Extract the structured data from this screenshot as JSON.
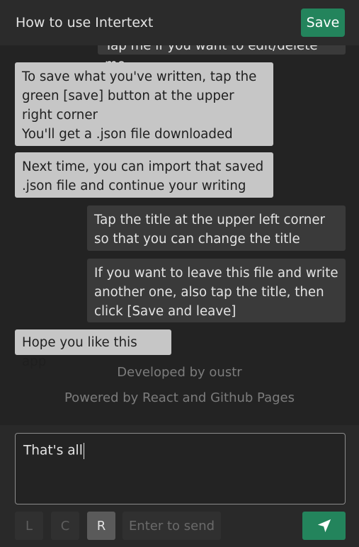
{
  "header": {
    "title": "How to use Intertext",
    "save_label": "Save"
  },
  "messages": [
    {
      "side": "right",
      "text": "Tap me if you want to edit/delete me"
    },
    {
      "side": "left",
      "text": "To save what you've written, tap the green [save] button at the upper right corner\nYou'll get a .json file downloaded"
    },
    {
      "side": "left",
      "text": "Next time, you can import that saved .json file and continue your writing"
    },
    {
      "side": "right",
      "text": "Tap the title at the upper left corner so that you can change the title"
    },
    {
      "side": "right",
      "text": "If you want to leave this file and write another one, also tap the title, then click [Save and leave]"
    },
    {
      "side": "left",
      "text": "Hope you like this app"
    }
  ],
  "footer": {
    "developer": "Developed by oustr",
    "powered": "Powered by React and Github Pages"
  },
  "composer": {
    "text": "That's all",
    "align_buttons": [
      {
        "label": "L",
        "active": false
      },
      {
        "label": "C",
        "active": false
      },
      {
        "label": "R",
        "active": true
      }
    ],
    "send_hint": "Enter to send"
  },
  "colors": {
    "accent": "#23845c",
    "left_bubble": "#c6c6c6",
    "right_bubble": "#3a3a3a",
    "background": "#232323"
  },
  "icons": {
    "send": "send-arrow-icon"
  }
}
